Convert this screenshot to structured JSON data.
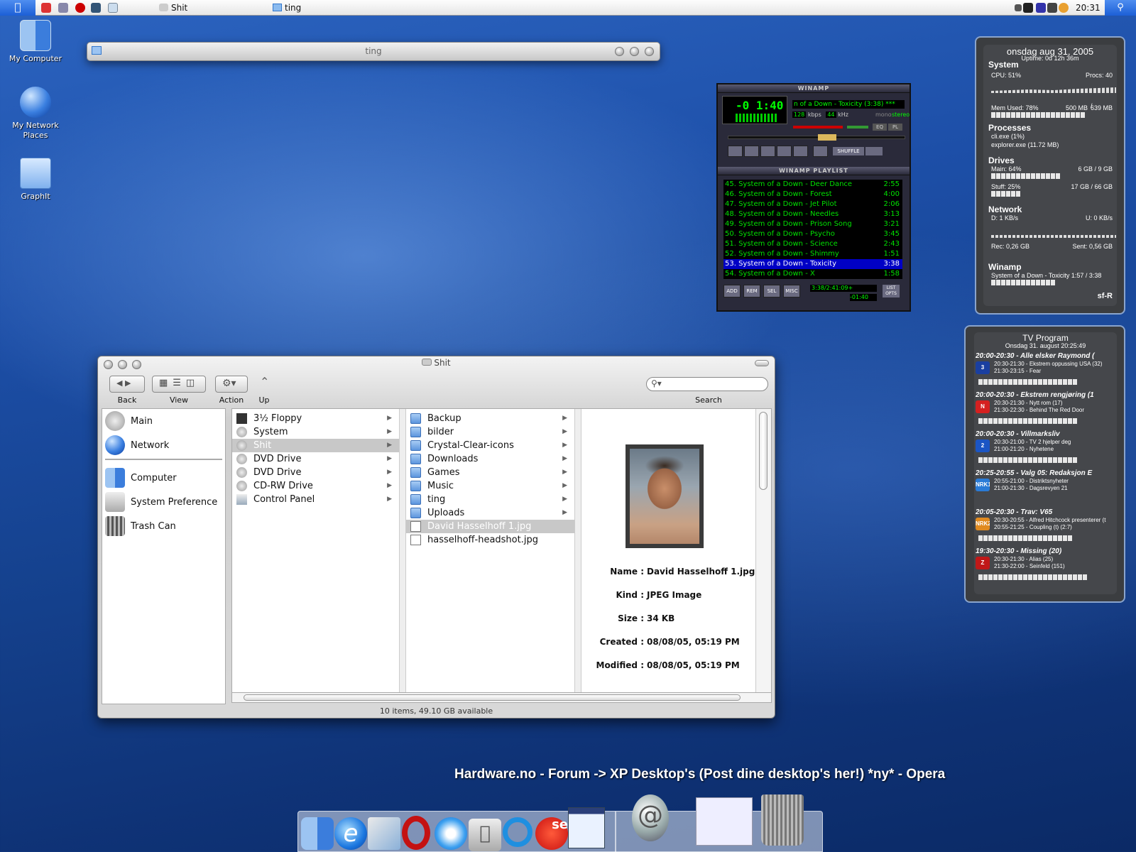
{
  "menubar": {
    "tasks": [
      {
        "label": "Shit"
      },
      {
        "label": "ting"
      }
    ],
    "clock": "20:31"
  },
  "desktop_icons": [
    {
      "label": "My Computer",
      "icon": "mac-finder-icon"
    },
    {
      "label": "My Network Places",
      "icon": "globe-icon"
    },
    {
      "label": "GraphIt",
      "icon": "folder-icon"
    }
  ],
  "ting_window": {
    "title": "ting"
  },
  "winamp": {
    "title": "WINAMP",
    "time": "-0 1:40",
    "song": "n of a Down - Toxicity (3:38) ***",
    "kbps": "128",
    "kbps_unit": "kbps",
    "khz": "44",
    "khz_unit": "kHz",
    "mono": "mono",
    "stereo": "stereo",
    "eq": "EQ",
    "pl": "PL",
    "shuffle": "SHUFFLE",
    "playlist_title": "WINAMP PLAYLIST",
    "playlist": [
      {
        "title": "45. System of a Down - Deer Dance",
        "dur": "2:55"
      },
      {
        "title": "46. System of a Down - Forest",
        "dur": "4:00"
      },
      {
        "title": "47. System of a Down - Jet Pilot",
        "dur": "2:06"
      },
      {
        "title": "48. System of a Down - Needles",
        "dur": "3:13"
      },
      {
        "title": "49. System of a Down - Prison Song",
        "dur": "3:21"
      },
      {
        "title": "50. System of a Down - Psycho",
        "dur": "3:45"
      },
      {
        "title": "51. System of a Down - Science",
        "dur": "2:43"
      },
      {
        "title": "52. System of a Down - Shimmy",
        "dur": "1:51"
      },
      {
        "title": "53. System of a Down - Toxicity",
        "dur": "3:38"
      },
      {
        "title": "54. System of a Down - X",
        "dur": "1:58"
      }
    ],
    "pl_buttons": [
      "ADD",
      "REM",
      "SEL",
      "MISC"
    ],
    "pl_time": "3:38/2:41:09+",
    "pl_remaining": "-01:40",
    "list_opts": "LIST OPTS"
  },
  "sysmon": {
    "date": "onsdag aug 31, 2005",
    "uptime": "Uptime: 0d 12h 36m",
    "system": "System",
    "cpu": "CPU: 51%",
    "procs": "Procs: 40",
    "mem_used": "Mem Used: 78%",
    "mem_500": "500 MB",
    "mem_slash": "/",
    "mem_639": "639 MB",
    "processes": "Processes",
    "proc1": "cli.exe (1%)",
    "proc2": "explorer.exe (11.72 MB)",
    "drives": "Drives",
    "main": "Main: 64%",
    "main_size": "6 GB / 9 GB",
    "stuff": "Stuff: 25%",
    "stuff_size": "17 GB / 66 GB",
    "network": "Network",
    "down": "D: 1 KB/s",
    "up": "U: 0 KB/s",
    "rec": "Rec: 0,26 GB",
    "sent": "Sent: 0,56 GB",
    "winamp": "Winamp",
    "winamp_song": "System of a Down - Toxicity  1:57 / 3:38",
    "sig": "sf-R"
  },
  "tv": {
    "title": "TV Program",
    "subtitle": "Onsdag 31. august 20:25:49",
    "channels": [
      {
        "head": "20:00-20:30 - Alle elsker Raymond (",
        "l1": "20:30-21:30 - Ekstrem oppussing USA (32)",
        "l2": "21:30-23:15 - Fear",
        "logo": "3",
        "color": "#1a3fa0"
      },
      {
        "head": "20:00-20:30 - Ekstrem rengjøring (1",
        "l1": "20:30-21:30 - Nytt rom (17)",
        "l2": "21:30-22:30 - Behind The Red Door",
        "logo": "N",
        "color": "#d52020"
      },
      {
        "head": "20:00-20:30 - Villmarksliv",
        "l1": "20:30-21:00 - TV 2 hjelper deg",
        "l2": "21:00-21:20 - Nyhetene",
        "logo": "2",
        "color": "#1b55c4"
      },
      {
        "head": "20:25-20:55 - Valg 05: Redaksjon E",
        "l1": "20:55-21:00 - Distriktsnyheter",
        "l2": "21:00-21:30 - Dagsrevyen 21",
        "logo": "NRK1",
        "color": "#2a7bd6"
      },
      {
        "head": "20:05-20:30 - Trav: V65",
        "l1": "20:30-20:55 - Alfred Hitchcock presenterer (t",
        "l2": "20:55-21:25 - Coupling (t) (2:7)",
        "logo": "NRK2",
        "color": "#e08a20"
      },
      {
        "head": "19:30-20:30 - Missing (20)",
        "l1": "20:30-21:30 - Alias (25)",
        "l2": "21:30-22:00 - Seinfeld (151)",
        "logo": "Z",
        "color": "#c01818"
      }
    ]
  },
  "finder": {
    "title": "Shit",
    "toolbar": {
      "back": "Back",
      "view": "View",
      "action": "Action",
      "up": "Up",
      "search": "Search",
      "search_placeholder": ""
    },
    "sidebar": [
      "Main",
      "Network",
      "Computer",
      "System Preference",
      "Trash Can"
    ],
    "col1": [
      "3½ Floppy",
      "System",
      "Shit",
      "DVD Drive",
      "DVD Drive",
      "CD-RW Drive",
      "Control Panel"
    ],
    "col2": [
      "Backup",
      "bilder",
      "Crystal-Clear-icons",
      "Downloads",
      "Games",
      "Music",
      "ting",
      "Uploads",
      "David Hasselhoff 1.jpg",
      "hasselhoff-headshot.jpg"
    ],
    "preview": {
      "name_label": "Name :",
      "name": "David Hasselhoff 1.jpg",
      "kind_label": "Kind :",
      "kind": "JPEG Image",
      "size_label": "Size :",
      "size": "34 KB",
      "created_label": "Created :",
      "created": "08/08/05, 05:19 PM",
      "modified_label": "Modified :",
      "modified": "08/08/05, 05:19 PM"
    },
    "status": "10 items, 49.10 GB available"
  },
  "opera_title": "Hardware.no - Forum -> XP Desktop's (Post dine desktop's her!) *ny* - Opera",
  "dock": [
    "finder-icon",
    "internet-explorer-icon",
    "mail-icon",
    "opera-icon",
    "quicktime-icon",
    "apple-icon",
    "quicktime-q-icon",
    "se-icon",
    "network-icon",
    "mail-at-icon",
    "opera-window-icon",
    "trash-icon"
  ]
}
